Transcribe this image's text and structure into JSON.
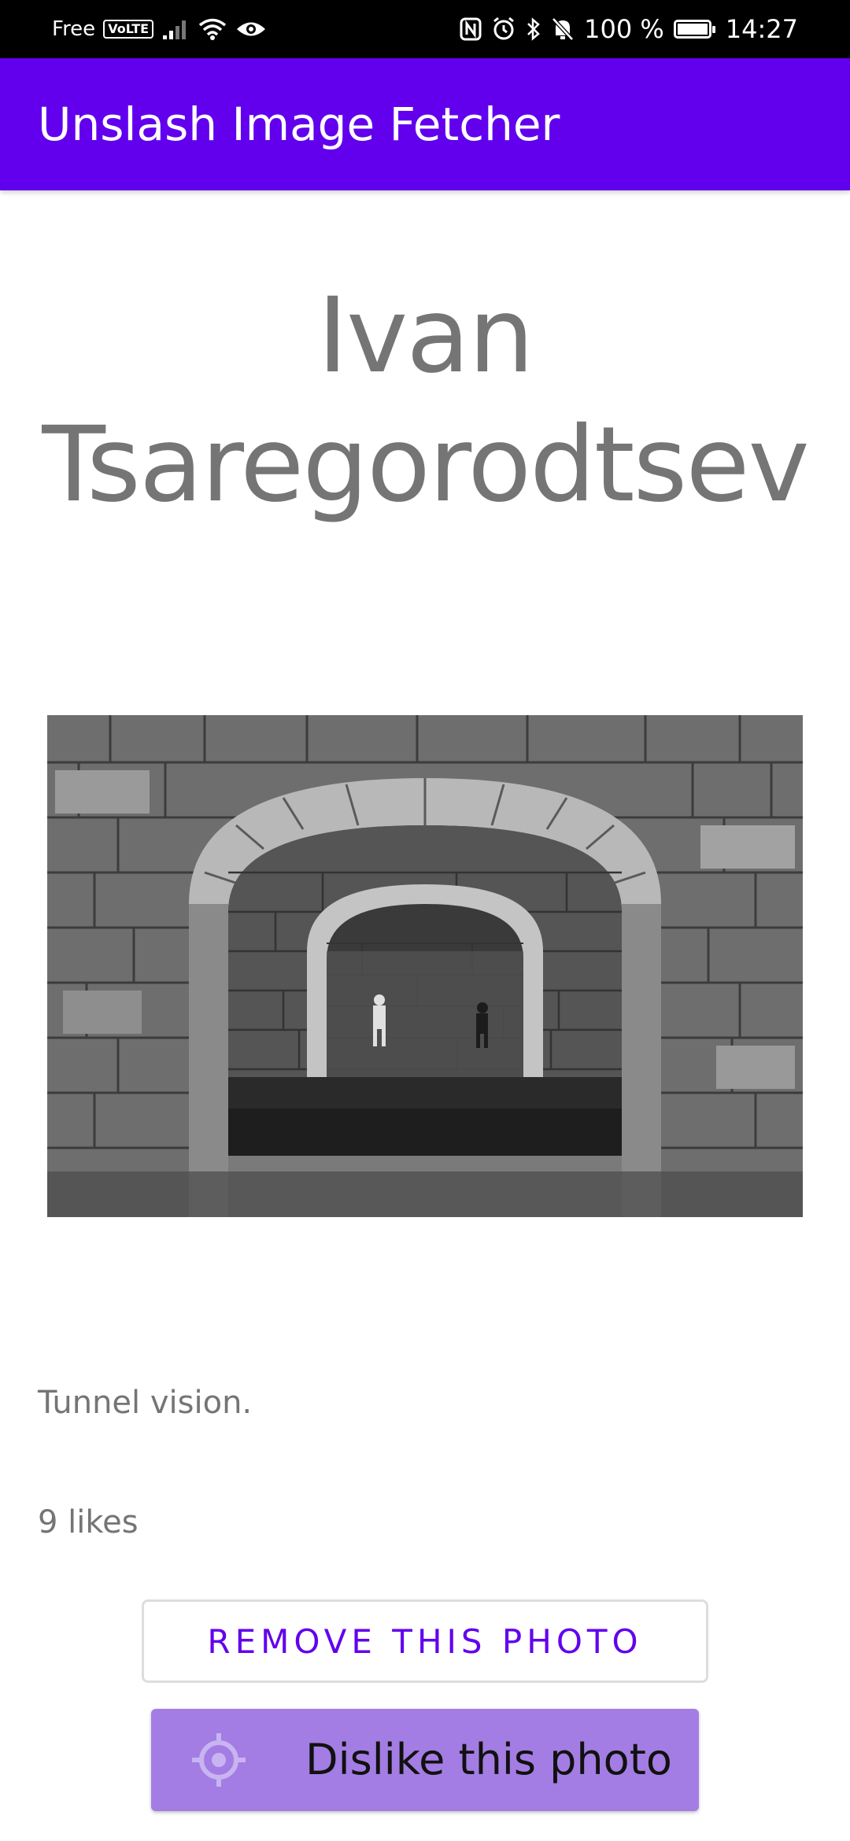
{
  "status_bar": {
    "carrier": "Free",
    "volte_badge": "VoLTE",
    "battery_percent": "100 %",
    "time": "14:27",
    "icons": [
      "signal-icon",
      "wifi-icon",
      "eye-icon",
      "nfc-icon",
      "alarm-icon",
      "bluetooth-icon",
      "mute-icon",
      "battery-icon"
    ]
  },
  "app_bar": {
    "title": "Unslash Image Fetcher",
    "color": "#6200ee"
  },
  "photo": {
    "author": "Ivan Tsaregorodtsev",
    "description": "Tunnel vision.",
    "likes": "9 likes"
  },
  "actions": {
    "remove_label": "REMOVE THIS PHOTO",
    "dislike_label": "Dislike this photo",
    "dislike_icon": "crosshair-icon"
  },
  "colors": {
    "primary": "#6200ee",
    "dislike_bg": "#a37de3",
    "text_secondary": "#757575"
  }
}
